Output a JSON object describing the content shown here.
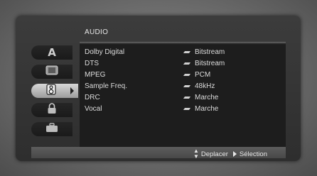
{
  "menu": {
    "title": "AUDIO",
    "items": [
      {
        "label": "Dolby Digital",
        "value": "Bitstream"
      },
      {
        "label": "DTS",
        "value": "Bitstream"
      },
      {
        "label": "MPEG",
        "value": "PCM"
      },
      {
        "label": "Sample Freq.",
        "value": "48kHz"
      },
      {
        "label": "DRC",
        "value": "Marche"
      },
      {
        "label": "Vocal",
        "value": "Marche"
      }
    ]
  },
  "sidebar": {
    "tabs": [
      {
        "icon": "language-a-icon"
      },
      {
        "icon": "display-icon"
      },
      {
        "icon": "speaker-icon",
        "active": true
      },
      {
        "icon": "lock-icon"
      },
      {
        "icon": "briefcase-icon"
      }
    ]
  },
  "footer": {
    "move_label": "Deplacer",
    "select_label": "Sélection"
  }
}
